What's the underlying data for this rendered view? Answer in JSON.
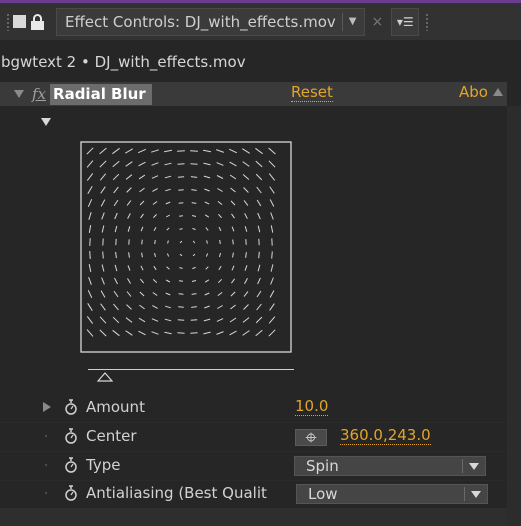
{
  "panel": {
    "tab_title": "Effect Controls: DJ_with_effects.mov",
    "tab_menu_icon": "panel-menu-icon",
    "lock_icon": "lock-icon",
    "source_line": "bgwtext 2 • DJ_with_effects.mov",
    "accent_color": "#e2a52a"
  },
  "effect": {
    "fx_label": "fx",
    "name": "Radial Blur",
    "reset_label": "Reset",
    "about_label": "Abou"
  },
  "properties": {
    "amount": {
      "label": "Amount",
      "value": "10.0"
    },
    "center": {
      "label": "Center",
      "value": "360.0,243.0"
    },
    "type": {
      "label": "Type",
      "value": "Spin"
    },
    "antialiasing": {
      "label": "Antialiasing (Best Qualit",
      "value": "Low"
    }
  }
}
